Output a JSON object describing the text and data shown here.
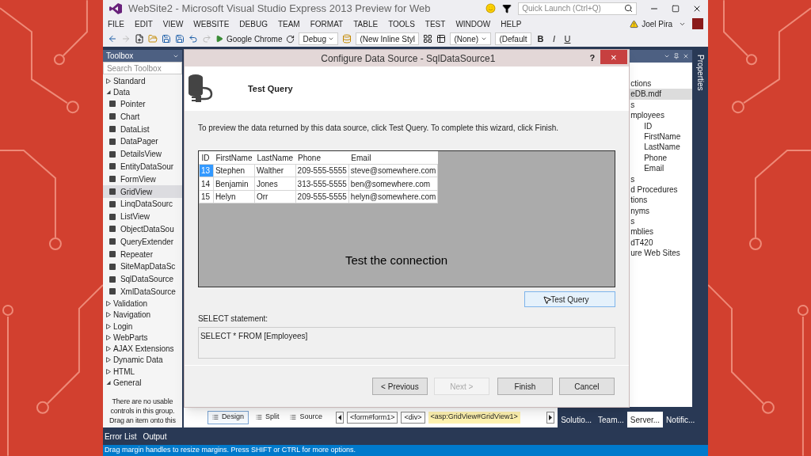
{
  "window": {
    "title": "WebSite2 - Microsoft Visual Studio Express 2013 Preview for Web"
  },
  "quick_launch": {
    "placeholder": "Quick Launch (Ctrl+Q)"
  },
  "menu": [
    "FILE",
    "EDIT",
    "VIEW",
    "WEBSITE",
    "DEBUG",
    "TEAM",
    "FORMAT",
    "TABLE",
    "TOOLS",
    "TEST",
    "WINDOW",
    "HELP"
  ],
  "user": {
    "name": "Joel Pira"
  },
  "toolbar": {
    "browser": "Google Chrome",
    "configuration": "Debug",
    "style": "(New Inline Styl",
    "css_class": "(None)",
    "font": "(Default",
    "format_buttons": [
      "B",
      "I",
      "U"
    ]
  },
  "toolbox": {
    "title": "Toolbox",
    "search": {
      "placeholder": "Search Toolbox"
    },
    "groups": [
      {
        "label": "Standard",
        "expanded": false
      },
      {
        "label": "Data",
        "expanded": true,
        "items": [
          {
            "label": "Pointer",
            "selected": false
          },
          {
            "label": "Chart",
            "selected": false
          },
          {
            "label": "DataList",
            "selected": false
          },
          {
            "label": "DataPager",
            "selected": false
          },
          {
            "label": "DetailsView",
            "selected": false
          },
          {
            "label": "EntityDataSour",
            "selected": false
          },
          {
            "label": "FormView",
            "selected": false
          },
          {
            "label": "GridView",
            "selected": true
          },
          {
            "label": "LinqDataSourc",
            "selected": false
          },
          {
            "label": "ListView",
            "selected": false
          },
          {
            "label": "ObjectDataSou",
            "selected": false
          },
          {
            "label": "QueryExtender",
            "selected": false
          },
          {
            "label": "Repeater",
            "selected": false
          },
          {
            "label": "SiteMapDataSc",
            "selected": false
          },
          {
            "label": "SqlDataSource",
            "selected": false
          },
          {
            "label": "XmlDataSource",
            "selected": false
          }
        ]
      },
      {
        "label": "Validation",
        "expanded": false
      },
      {
        "label": "Navigation",
        "expanded": false
      },
      {
        "label": "Login",
        "expanded": false
      },
      {
        "label": "WebParts",
        "expanded": false
      },
      {
        "label": "AJAX Extensions",
        "expanded": false
      },
      {
        "label": "Dynamic Data",
        "expanded": false
      },
      {
        "label": "HTML",
        "expanded": false
      },
      {
        "label": "General",
        "expanded": true
      }
    ],
    "empty_message": [
      "There are no usable",
      "controls in this group.",
      "Drag an item onto this"
    ]
  },
  "dialog": {
    "title": "Configure Data Source - SqlDataSource1",
    "help": "?",
    "close": "×",
    "heading": "Test Query",
    "instruction": "To preview the data returned by this data source, click Test Query. To complete this wizard, click Finish.",
    "grid": {
      "columns": [
        "ID",
        "FirstName",
        "LastName",
        "Phone",
        "Email"
      ],
      "rows": [
        {
          "selected": true,
          "cells": [
            "13",
            "Stephen",
            "Walther",
            "209-555-5555",
            "steve@somewhere.com"
          ]
        },
        {
          "selected": false,
          "cells": [
            "14",
            "Benjamin",
            "Jones",
            "313-555-5555",
            "ben@somewhere.com"
          ]
        },
        {
          "selected": false,
          "cells": [
            "15",
            "Helyn",
            "Orr",
            "209-555-5555",
            "helyn@somewhere.com"
          ]
        }
      ]
    },
    "caption": "Test the connection",
    "test_button": "Test Query",
    "statement_label": "SELECT statement:",
    "statement": "SELECT * FROM [Employees]",
    "buttons": [
      {
        "label": "< Previous",
        "disabled": false
      },
      {
        "label": "Next >",
        "disabled": true
      },
      {
        "label": "Finish",
        "disabled": false
      },
      {
        "label": "Cancel",
        "disabled": false
      }
    ]
  },
  "designer": {
    "views": [
      {
        "label": "Design",
        "selected": true
      },
      {
        "label": "Split",
        "selected": false
      },
      {
        "label": "Source",
        "selected": false
      }
    ],
    "breadcrumb": [
      {
        "label": "<form#form1>",
        "selected": false
      },
      {
        "label": "<div>",
        "selected": false
      },
      {
        "label": "<asp:GridView#GridView1>",
        "selected": true
      }
    ]
  },
  "server_explorer": {
    "nodes": [
      {
        "label": "ctions",
        "selected": false,
        "children": [
          {
            "label": "eDB.mdf",
            "selected": true,
            "children": [
              {
                "label": "s",
                "selected": false,
                "children": [
                  {
                    "label": "mployees",
                    "selected": false,
                    "children": [
                      {
                        "label": "ID",
                        "selected": false
                      },
                      {
                        "label": "FirstName",
                        "selected": false
                      },
                      {
                        "label": "LastName",
                        "selected": false
                      },
                      {
                        "label": "Phone",
                        "selected": false
                      },
                      {
                        "label": "Email",
                        "selected": false
                      }
                    ]
                  }
                ]
              },
              {
                "label": "s",
                "selected": false
              },
              {
                "label": "d Procedures",
                "selected": false
              },
              {
                "label": "tions",
                "selected": false
              },
              {
                "label": "nyms",
                "selected": false
              },
              {
                "label": "s",
                "selected": false
              },
              {
                "label": "mblies",
                "selected": false
              }
            ]
          }
        ]
      },
      {
        "label": "dT420",
        "selected": false
      },
      {
        "label": "ure Web Sites",
        "selected": false
      }
    ]
  },
  "side_tab": "Properties",
  "panel_tabs": [
    {
      "label": "Solutio...",
      "selected": false
    },
    {
      "label": "Team...",
      "selected": false
    },
    {
      "label": "Server...",
      "selected": true
    },
    {
      "label": "Notific...",
      "selected": false
    }
  ],
  "bottom_tabs": [
    "Error List",
    "Output"
  ],
  "status_bar": "Drag margin handles to resize margins. Press SHIFT or CTRL for more options."
}
